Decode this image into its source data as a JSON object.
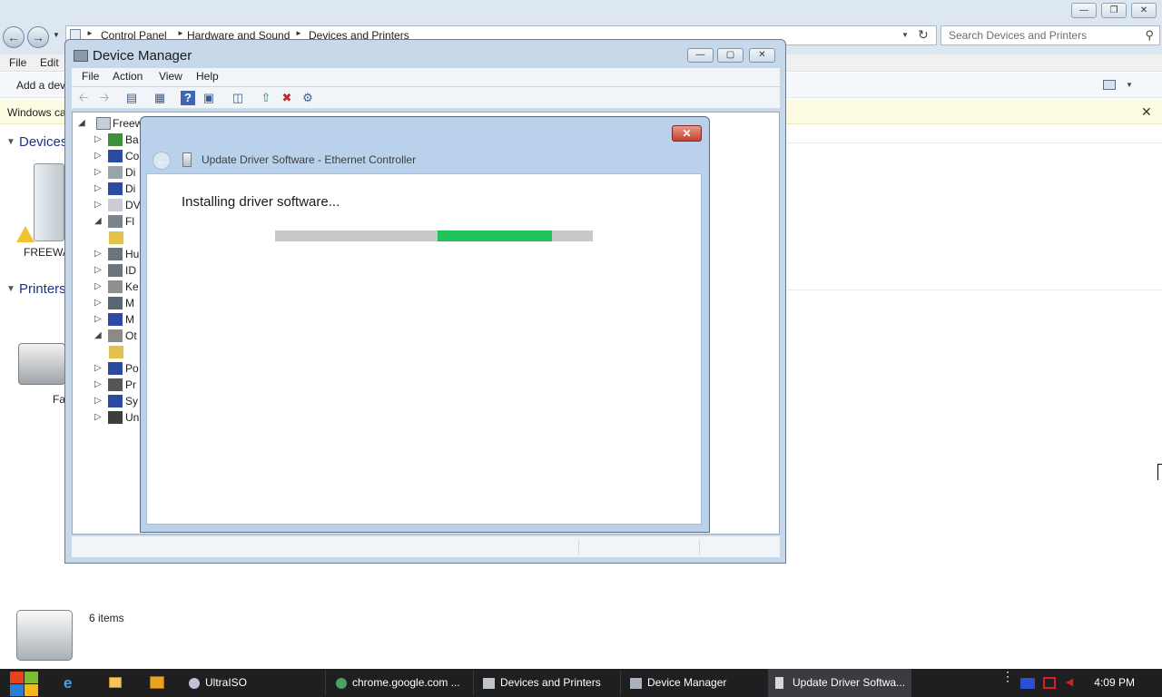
{
  "devices_window": {
    "breadcrumbs": [
      "Control Panel",
      "Hardware and Sound",
      "Devices and Printers"
    ],
    "search_placeholder": "Search Devices and Printers",
    "menu": [
      "File",
      "Edit"
    ],
    "command_add_device": "Add a dev",
    "infobar_text": "Windows ca",
    "sections": {
      "devices": "Devices",
      "printers": "Printers"
    },
    "device_labels": [
      "FREEWA",
      "Fa"
    ],
    "items_count": "6 items"
  },
  "device_manager": {
    "title": "Device Manager",
    "menu": [
      "File",
      "Action",
      "View",
      "Help"
    ],
    "tree_root": "Freew",
    "tree_items": [
      "Ba",
      "Co",
      "Di",
      "Di",
      "DV",
      "Fl",
      "",
      "Hu",
      "ID",
      "Ke",
      "M",
      "M",
      "Ot",
      "",
      "Po",
      "Pr",
      "Sy",
      "Un"
    ]
  },
  "update_driver": {
    "title": "Update Driver Software - Ethernet Controller",
    "heading": "Installing driver software...",
    "progress_fraction_start": 0.51,
    "progress_fraction_end": 0.87
  },
  "taskbar": {
    "buttons": [
      "UltraISO",
      "chrome.google.com ...",
      "Devices and Printers",
      "Device Manager",
      "Update Driver Softwa..."
    ],
    "clock": "4:09 PM"
  },
  "colors": {
    "progress_fill": "#22c25a",
    "dialog_frame": "#b9d1ea",
    "close_red": "#c2412e",
    "taskbar": "#1f1f22"
  }
}
